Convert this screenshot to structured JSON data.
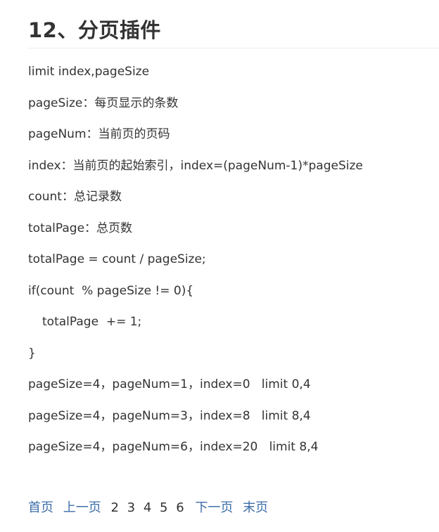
{
  "heading": "12、分页插件",
  "lines": [
    "limit index,pageSize",
    "pageSize：每页显示的条数",
    "pageNum：当前页的页码",
    "index：当前页的起始索引，index=(pageNum-1)*pageSize",
    "count：总记录数",
    "totalPage：总页数",
    "totalPage = count / pageSize;",
    "if(count  % pageSize != 0){",
    "totalPage  += 1;",
    "}",
    "pageSize=4，pageNum=1，index=0   limit 0,4",
    "pageSize=4，pageNum=3，index=8   limit 8,4",
    "pageSize=4，pageNum=6，index=20   limit 8,4"
  ],
  "pager": {
    "first": "首页",
    "prev": "上一页",
    "pages": [
      "2",
      "3",
      "4",
      "5",
      "6"
    ],
    "next": "下一页",
    "last": "末页"
  }
}
